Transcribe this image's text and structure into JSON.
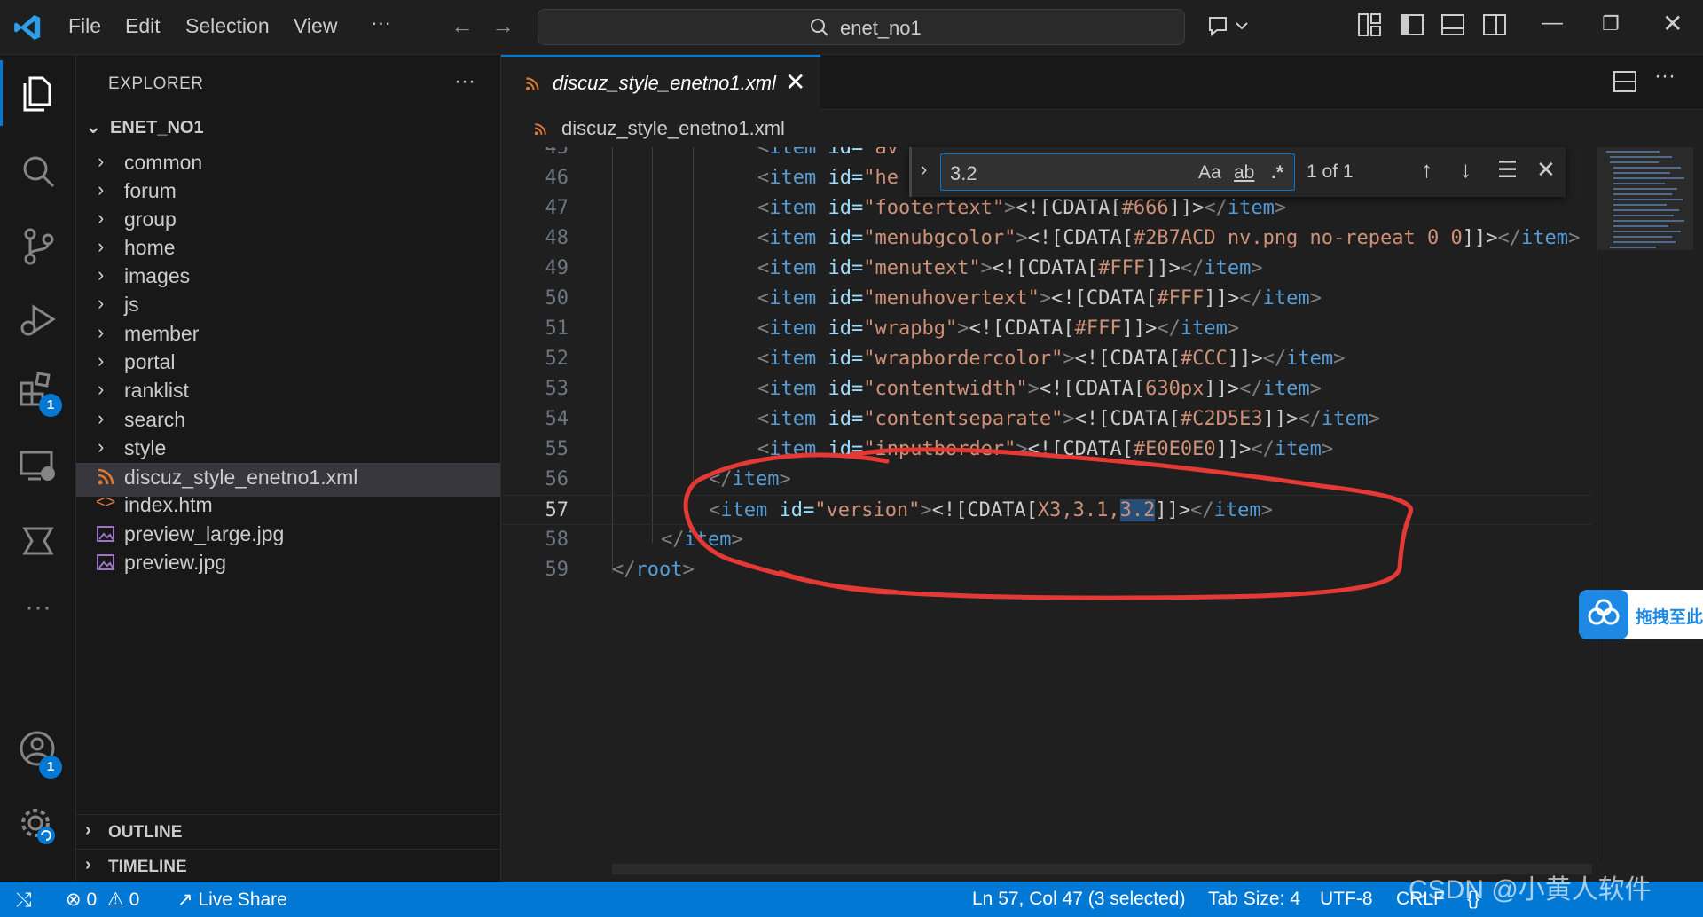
{
  "titlebar": {
    "menus": [
      "File",
      "Edit",
      "Selection",
      "View"
    ],
    "more": "···",
    "search_text": "enet_no1"
  },
  "activity": {
    "extensions_badge": "1",
    "accounts_badge": "1"
  },
  "sidebar": {
    "title": "EXPLORER",
    "more": "···",
    "folder": "ENET_NO1",
    "folders": [
      "common",
      "forum",
      "group",
      "home",
      "images",
      "js",
      "member",
      "portal",
      "ranklist",
      "search",
      "style"
    ],
    "files": [
      {
        "name": "discuz_style_enetno1.xml",
        "icon": "rss-icon"
      },
      {
        "name": "index.htm",
        "icon": "html-icon"
      },
      {
        "name": "preview_large.jpg",
        "icon": "image-icon"
      },
      {
        "name": "preview.jpg",
        "icon": "image-icon"
      }
    ],
    "outline": "OUTLINE",
    "timeline": "TIMELINE"
  },
  "editor": {
    "tab_label": "discuz_style_enetno1.xml",
    "breadcrumb": "discuz_style_enetno1.xml",
    "line_numbers": [
      "45",
      "46",
      "47",
      "48",
      "49",
      "50",
      "51",
      "52",
      "53",
      "54",
      "55",
      "56",
      "57",
      "58",
      "59"
    ],
    "lines": {
      "l45": {
        "open": "<",
        "tag": "item",
        "attr": " id=",
        "val": "\"av"
      },
      "l46": {
        "open": "<",
        "tag": "item",
        "attr": " id=",
        "val": "\"he"
      },
      "l47": {
        "id": "\"footertext\"",
        "cdata": "#666"
      },
      "l48": {
        "id": "\"menubgcolor\"",
        "cdata": "#2B7ACD nv.png no-repeat 0 0"
      },
      "l49": {
        "id": "\"menutext\"",
        "cdata": "#FFF"
      },
      "l50": {
        "id": "\"menuhovertext\"",
        "cdata": "#FFF"
      },
      "l51": {
        "id": "\"wrapbg\"",
        "cdata": "#FFF"
      },
      "l52": {
        "id": "\"wrapbordercolor\"",
        "cdata": "#CCC"
      },
      "l53": {
        "id": "\"contentwidth\"",
        "cdata": "630px"
      },
      "l54": {
        "id": "\"contentseparate\"",
        "cdata": "#C2D5E3"
      },
      "l55": {
        "id": "\"inputborder\"",
        "cdata": "#E0E0E0"
      },
      "l57": {
        "id": "\"version\"",
        "cdata_before": "X3,3.1,",
        "cdata_sel": "3.2"
      }
    },
    "tokens": {
      "open": "<",
      "close_open": "</",
      "gt": ">",
      "item": "item",
      "root": "root",
      "id_attr": " id=",
      "cdata_open": "<![CDATA[",
      "cdata_close": "]]>"
    }
  },
  "find": {
    "value": "3.2",
    "match_case": "Aa",
    "whole_word": "ab",
    "regex": ".*",
    "count": "1 of 1"
  },
  "floating": {
    "label": "拖拽至此"
  },
  "statusbar": {
    "errors": "0",
    "warnings": "0",
    "live_share": "Live Share",
    "position": "Ln 57, Col 47 (3 selected)",
    "tab_size": "Tab Size: 4",
    "encoding": "UTF-8",
    "eol": "CRLF",
    "language": "{}",
    "watermark": "CSDN @小黄人软件"
  },
  "colors": {
    "accent": "#0078d4",
    "annotation": "#e53935"
  }
}
